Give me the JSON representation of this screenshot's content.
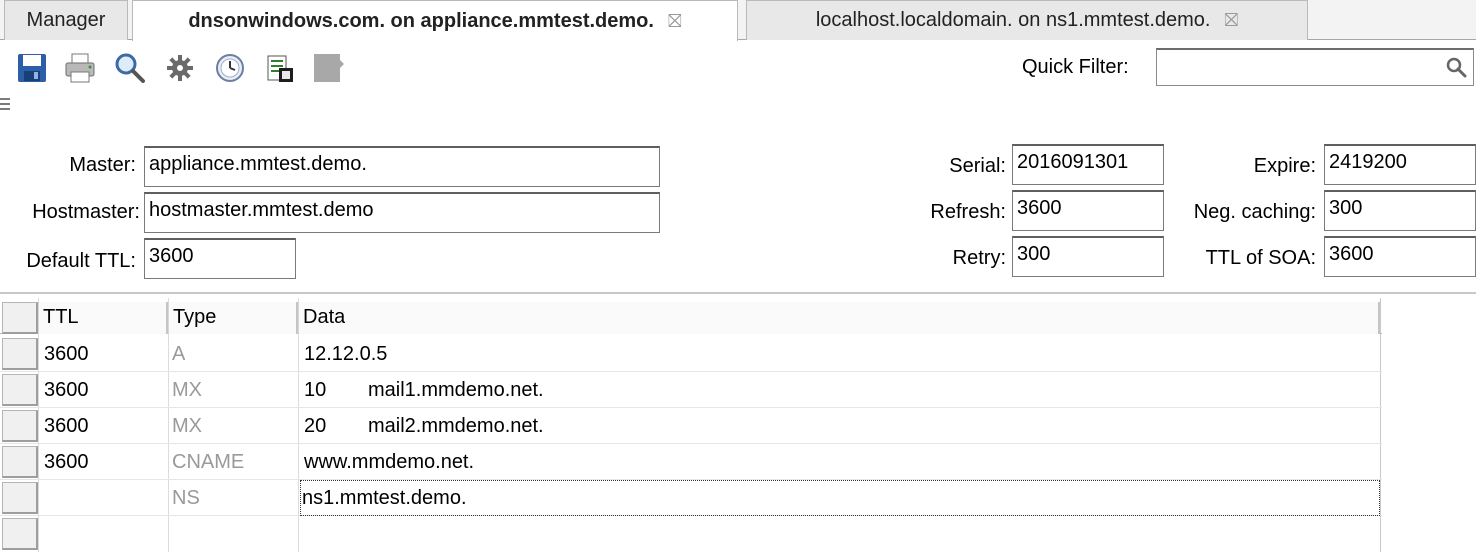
{
  "tabs": [
    {
      "label": "Manager"
    },
    {
      "label": "dnsonwindows.com. on appliance.mmtest.demo.",
      "close": "⛝"
    },
    {
      "label": "localhost.localdomain. on ns1.mmtest.demo.",
      "close": "⛝"
    }
  ],
  "toolbar": {
    "icons": [
      "save-icon",
      "print-icon",
      "search-icon",
      "settings-icon",
      "history-icon",
      "script-icon",
      "record-icon"
    ],
    "quick_filter_label": "Quick Filter:",
    "quick_filter_value": "",
    "quick_filter_placeholder": ""
  },
  "soa": {
    "master_label": "Master:",
    "master_value": "appliance.mmtest.demo.",
    "hostmaster_label": "Hostmaster:",
    "hostmaster_value": "hostmaster.mmtest.demo",
    "default_ttl_label": "Default TTL:",
    "default_ttl_value": "3600",
    "serial_label": "Serial:",
    "serial_value": "2016091301",
    "refresh_label": "Refresh:",
    "refresh_value": "3600",
    "retry_label": "Retry:",
    "retry_value": "300",
    "expire_label": "Expire:",
    "expire_value": "2419200",
    "neg_caching_label": "Neg. caching:",
    "neg_caching_value": "300",
    "ttl_soa_label": "TTL of SOA:",
    "ttl_soa_value": "3600"
  },
  "records": {
    "columns": [
      "TTL",
      "Type",
      "Data"
    ],
    "rows": [
      {
        "ttl": "3600",
        "type": "A",
        "data": "12.12.0.5",
        "pref": ""
      },
      {
        "ttl": "3600",
        "type": "MX",
        "pref": "10",
        "data": "mail1.mmdemo.net."
      },
      {
        "ttl": "3600",
        "type": "MX",
        "pref": "20",
        "data": "mail2.mmdemo.net."
      },
      {
        "ttl": "3600",
        "type": "CNAME",
        "data": "www.mmdemo.net.",
        "pref": ""
      },
      {
        "ttl": "",
        "type": "NS",
        "data": "ns1.mmtest.demo.",
        "pref": ""
      },
      {
        "ttl": "",
        "type": "",
        "data": "",
        "pref": ""
      }
    ]
  }
}
